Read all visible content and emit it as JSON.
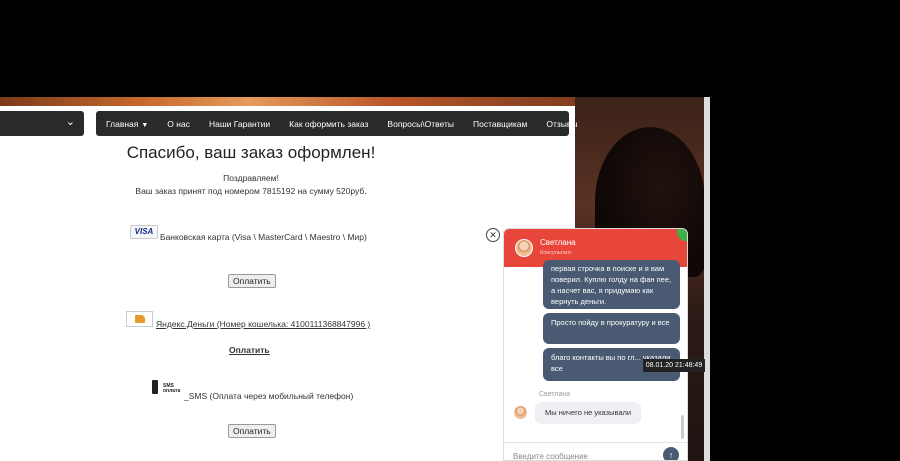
{
  "nav": {
    "items": [
      {
        "label": "Главная",
        "has_dropdown": true
      },
      {
        "label": "О нас"
      },
      {
        "label": "Наши Гарантии"
      },
      {
        "label": "Как оформить заказ"
      },
      {
        "label": "Вопросы\\Ответы"
      },
      {
        "label": "Поставщикам"
      },
      {
        "label": "Отзывы"
      }
    ]
  },
  "order": {
    "title": "Спасибо, ваш заказ оформлен!",
    "congrats": "Поздравляем!",
    "summary": "Ваш заказ принят под номером 7815192 на сумму 520руб."
  },
  "payment": {
    "card": {
      "icon_text": "VISA",
      "label": "Банковская карта (Visa \\ MasterCard \\ Maestro \\ Мир)",
      "button": "Оплатить"
    },
    "yandex": {
      "label": "Яндекс.Деньги (Номер кошелька: 4100111368847996 )",
      "link": "Оплатить"
    },
    "sms": {
      "icon_text": "SMS оплата",
      "label": "_SMS (Оплата через мобильный телефон)",
      "button": "Оплатить"
    }
  },
  "chat": {
    "agent_name": "Светлана",
    "agent_role": "Консультант",
    "messages": [
      {
        "from": "user",
        "text": "первая строчка в поиске и я вам поверил. Куплю голду на фан пее, а насчет вас, я придумаю как вернуть деньги."
      },
      {
        "from": "user",
        "text": "Просто пойду в прокуратуру и все"
      },
      {
        "from": "user",
        "text": "благо контакты вы по гл... указали все"
      },
      {
        "from": "agent",
        "sender": "Светлана",
        "text": "Мы ничего не указывали"
      }
    ],
    "timestamp": "08.01.20 21:48:49",
    "input_placeholder": "Введите сообщение",
    "send_icon": "arrow-up-icon"
  },
  "colors": {
    "chat_header": "#e8463a",
    "online": "#3cb34a",
    "bubble": "#4a5a72",
    "nav": "#2a2a2a"
  }
}
